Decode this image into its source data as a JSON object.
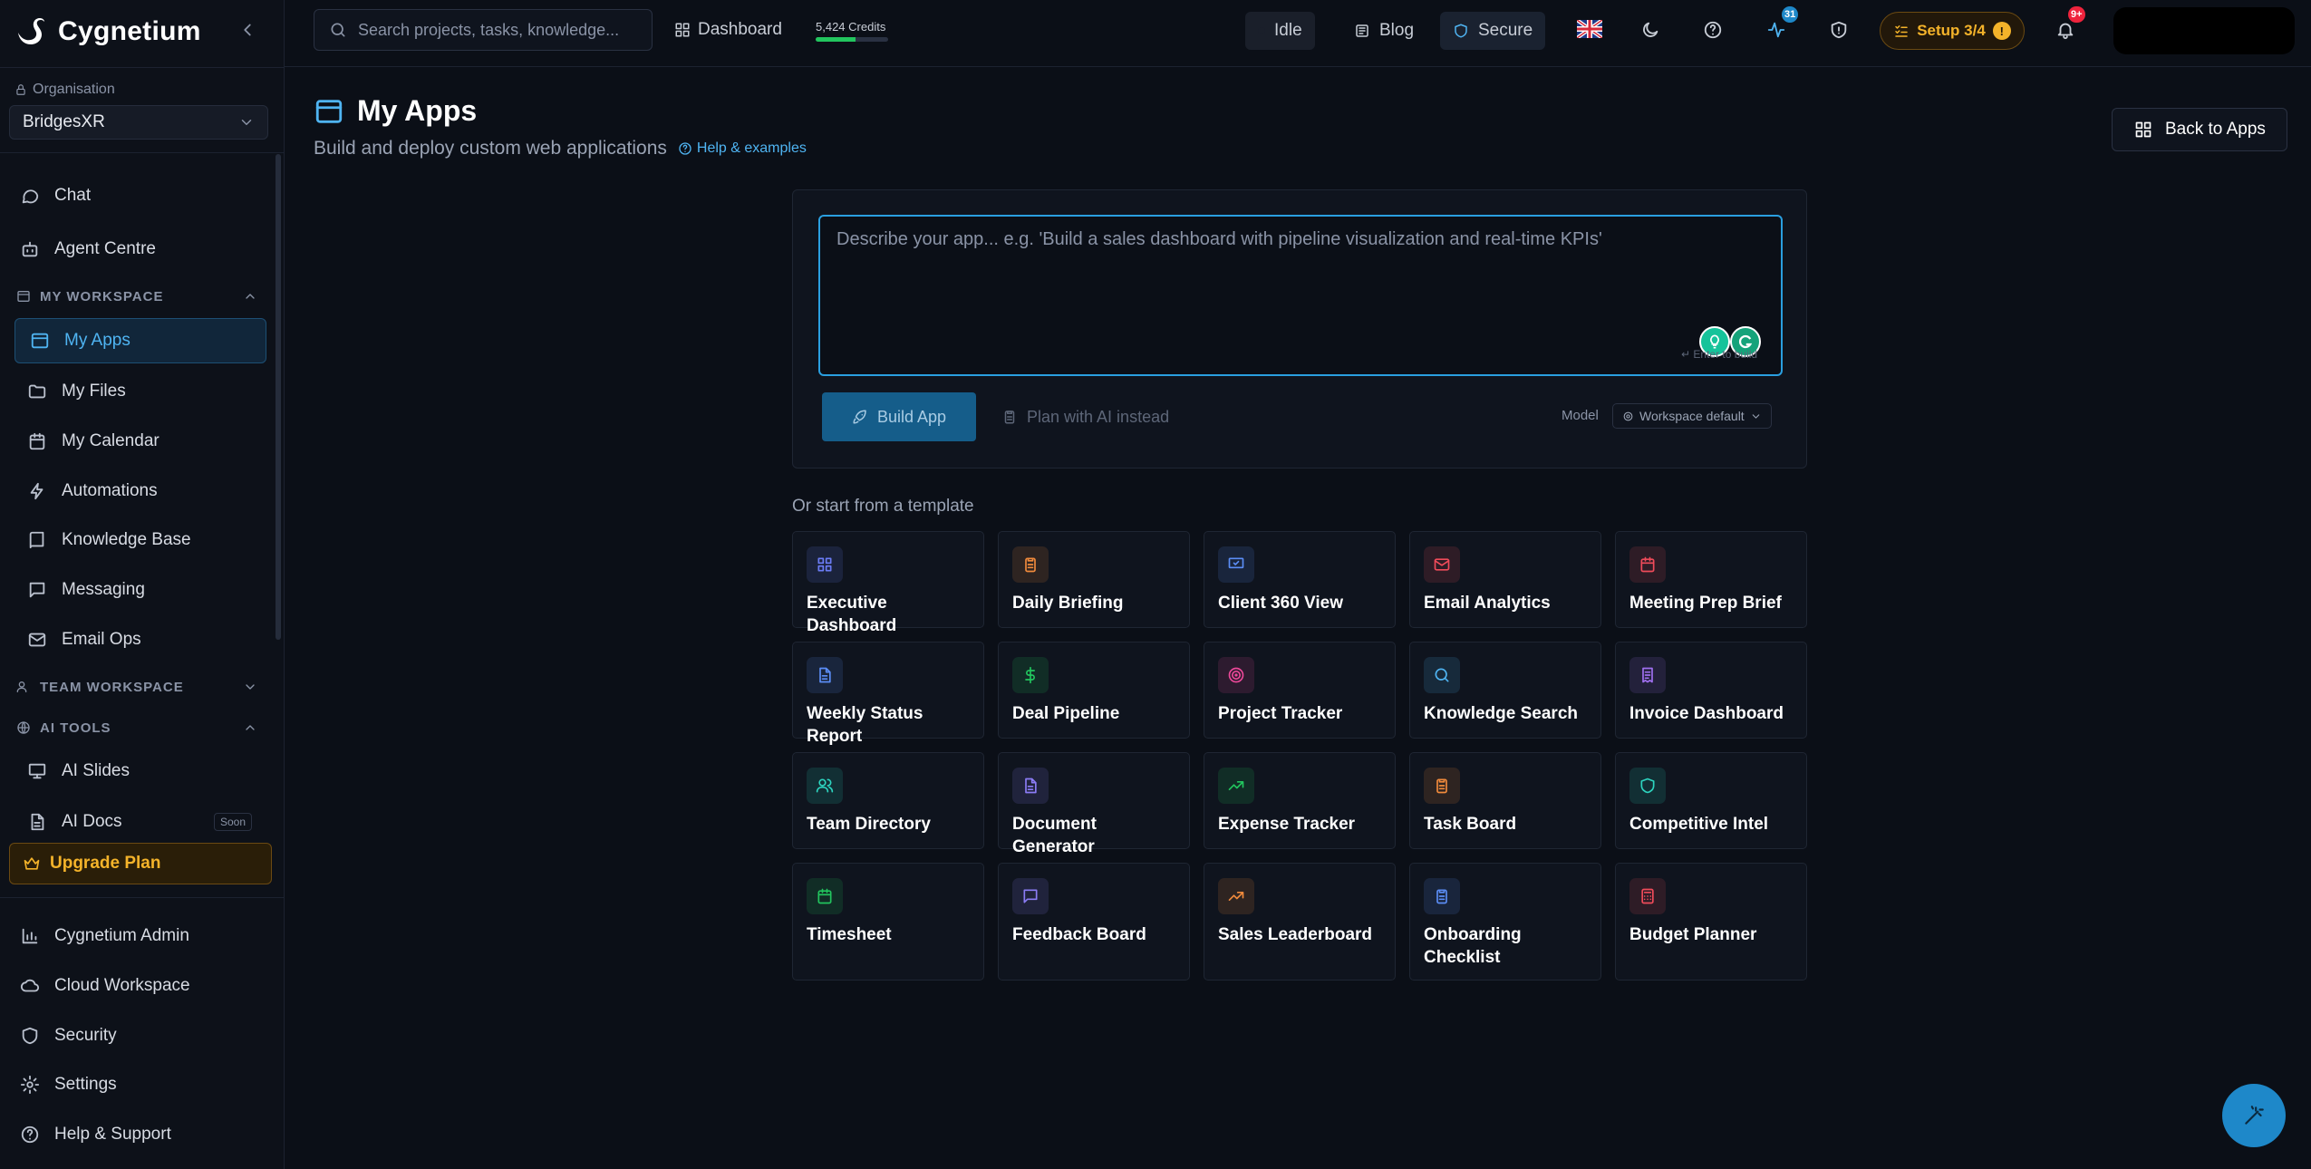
{
  "brand": {
    "name": "Cygnetium"
  },
  "sidebar": {
    "org_label": "Organisation",
    "org_value": "BridgesXR",
    "items_top": [
      {
        "label": "Chat",
        "icon": "chat-icon"
      },
      {
        "label": "Agent Centre",
        "icon": "bot-icon"
      }
    ],
    "my_workspace": {
      "title": "MY WORKSPACE",
      "items": [
        {
          "label": "My Apps",
          "icon": "app-window-icon",
          "active": true
        },
        {
          "label": "My Files",
          "icon": "folder-icon"
        },
        {
          "label": "My Calendar",
          "icon": "calendar-icon"
        },
        {
          "label": "Automations",
          "icon": "lightning-icon"
        },
        {
          "label": "Knowledge Base",
          "icon": "book-icon"
        },
        {
          "label": "Messaging",
          "icon": "message-icon"
        },
        {
          "label": "Email Ops",
          "icon": "mail-icon"
        }
      ]
    },
    "team_workspace": {
      "title": "TEAM WORKSPACE"
    },
    "ai_tools": {
      "title": "AI TOOLS",
      "items": [
        {
          "label": "AI Slides",
          "icon": "presentation-icon"
        },
        {
          "label": "AI Docs",
          "icon": "document-icon",
          "badge": "Soon"
        }
      ]
    },
    "upgrade_label": "Upgrade Plan",
    "items_bottom": [
      {
        "label": "Cygnetium Admin",
        "icon": "bar-chart-icon"
      },
      {
        "label": "Cloud Workspace",
        "icon": "cloud-icon"
      },
      {
        "label": "Security",
        "icon": "shield-icon"
      },
      {
        "label": "Settings",
        "icon": "gear-icon"
      },
      {
        "label": "Help & Support",
        "icon": "help-circle-icon"
      }
    ]
  },
  "topbar": {
    "search_placeholder": "Search projects, tasks, knowledge...",
    "dashboard_label": "Dashboard",
    "credits_label": "5,424 Credits",
    "credits_fill_fraction": 0.55,
    "idle_label": "Idle",
    "blog_label": "Blog",
    "secure_label": "Secure",
    "activity_badge": "31",
    "setup_label": "Setup 3/4",
    "setup_alert": "!",
    "notifications_badge": "9+"
  },
  "main": {
    "title": "My Apps",
    "subtitle": "Build and deploy custom web applications",
    "help_label": "Help & examples",
    "back_label": "Back to Apps",
    "prompt_placeholder": "Describe your app... e.g. 'Build a sales dashboard with pipeline visualization and real-time KPIs'",
    "prompt_hint": "↵ Enter to build",
    "build_label": "Build App",
    "plan_label": "Plan with AI instead",
    "model_label": "Model",
    "model_value": "Workspace default",
    "templates_heading": "Or start from a template",
    "templates": [
      {
        "name": "Executive Dashboard",
        "icon": "grid-icon",
        "color": "#6b7cf5"
      },
      {
        "name": "Daily Briefing",
        "icon": "clipboard-icon",
        "color": "#f08a3c"
      },
      {
        "name": "Client 360 View",
        "icon": "presentation-icon",
        "color": "#5b8df5"
      },
      {
        "name": "Email Analytics",
        "icon": "mail-icon",
        "color": "#ef4b5a"
      },
      {
        "name": "Meeting Prep Brief",
        "icon": "calendar-icon",
        "color": "#ef4b5a"
      },
      {
        "name": "Weekly Status Report",
        "icon": "document-icon",
        "color": "#5b8df5"
      },
      {
        "name": "Deal Pipeline",
        "icon": "dollar-icon",
        "color": "#22c55e"
      },
      {
        "name": "Project Tracker",
        "icon": "target-icon",
        "color": "#ec4899"
      },
      {
        "name": "Knowledge Search",
        "icon": "search-icon",
        "color": "#4fb4f2"
      },
      {
        "name": "Invoice Dashboard",
        "icon": "receipt-icon",
        "color": "#a070f0"
      },
      {
        "name": "Team Directory",
        "icon": "users-icon",
        "color": "#2dd4bf"
      },
      {
        "name": "Document Generator",
        "icon": "document-icon",
        "color": "#8b7cf5"
      },
      {
        "name": "Expense Tracker",
        "icon": "trending-up-icon",
        "color": "#22c55e"
      },
      {
        "name": "Task Board",
        "icon": "clipboard-icon",
        "color": "#f08a3c"
      },
      {
        "name": "Competitive Intel",
        "icon": "shield-icon",
        "color": "#2dd4bf"
      },
      {
        "name": "Timesheet",
        "icon": "calendar-icon",
        "color": "#22c55e"
      },
      {
        "name": "Feedback Board",
        "icon": "message-icon",
        "color": "#8b7cf5"
      },
      {
        "name": "Sales Leaderboard",
        "icon": "trending-up-icon",
        "color": "#f08a3c"
      },
      {
        "name": "Onboarding Checklist",
        "icon": "clipboard-icon",
        "color": "#5b8df5"
      },
      {
        "name": "Budget Planner",
        "icon": "calculator-icon",
        "color": "#ef4b5a"
      }
    ]
  },
  "colors": {
    "accent": "#4fb4f2",
    "warning": "#f4b32a",
    "danger": "#ef233c"
  }
}
